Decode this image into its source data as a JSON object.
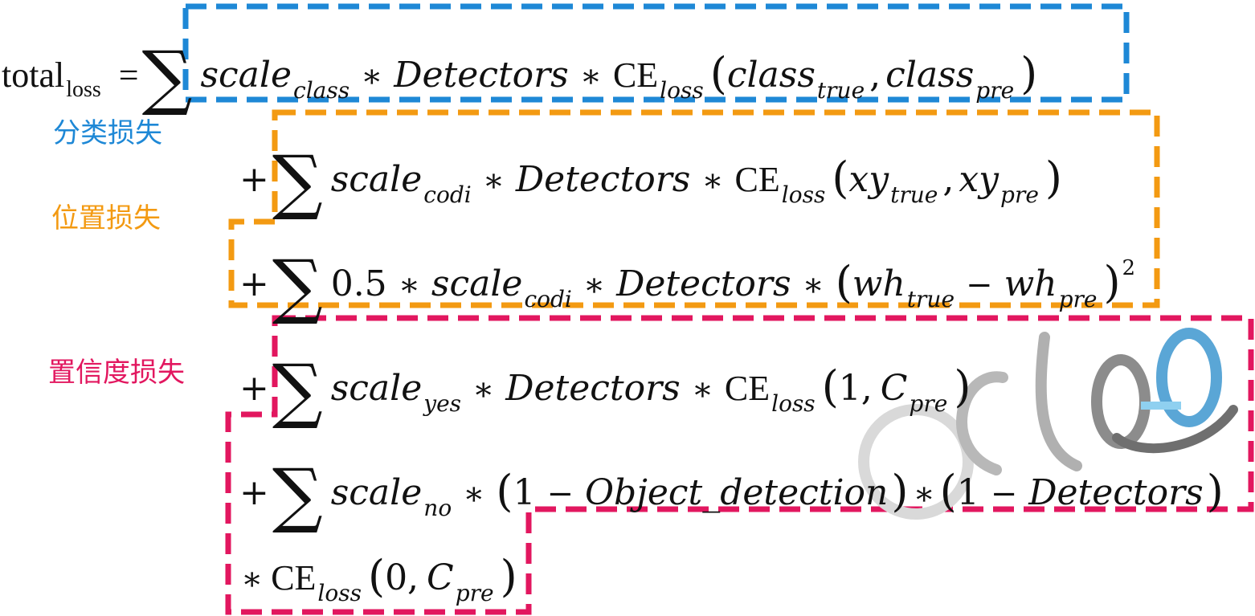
{
  "colors": {
    "class": "#1e88d6",
    "position": "#f39a12",
    "confidence": "#e2175f",
    "text": "#111111"
  },
  "labels": {
    "class_loss": "分类损失",
    "position_loss": "位置损失",
    "confidence_loss": "置信度损失"
  },
  "equation": {
    "lhs": {
      "total": "total",
      "loss_sub": "loss",
      "eq": "="
    },
    "term1": {
      "scale": "scale",
      "scale_sub": "class",
      "mul": "∗",
      "detectors": "Detectors",
      "mul2": "∗",
      "ce": "CE",
      "ce_sub": "loss",
      "arg1": "class",
      "arg1_sub": "true",
      "comma": ",",
      "arg2": "class",
      "arg2_sub": "pre"
    },
    "term2": {
      "plus": "+",
      "scale": "scale",
      "scale_sub": "codi",
      "mul": "∗",
      "detectors": "Detectors",
      "mul2": "∗",
      "ce": "CE",
      "ce_sub": "loss",
      "arg1": "xy",
      "arg1_sub": "true",
      "comma": ",",
      "arg2": "xy",
      "arg2_sub": "pre"
    },
    "term3": {
      "plus": "+",
      "coef": "0.5",
      "mul0": "∗",
      "scale": "scale",
      "scale_sub": "codi",
      "mul": "∗",
      "detectors": "Detectors",
      "mul2": "∗",
      "arg1": "wh",
      "arg1_sub": "true",
      "minus": "−",
      "arg2": "wh",
      "arg2_sub": "pre",
      "exp": "2"
    },
    "term4": {
      "plus": "+",
      "scale": "scale",
      "scale_sub": "yes",
      "mul": "∗",
      "detectors": "Detectors",
      "mul2": "∗",
      "ce": "CE",
      "ce_sub": "loss",
      "arg1": "1,",
      "arg2": "C",
      "arg2_sub": "pre"
    },
    "term5": {
      "plus": "+",
      "scale": "scale",
      "scale_sub": "no",
      "mul": "∗",
      "one1": "1",
      "minus1": "−",
      "obj": "Object_detection",
      "mul2": "∗",
      "one2": "1",
      "minus2": "−",
      "detectors": "Detectors"
    },
    "term6": {
      "mul": "∗",
      "ce": "CE",
      "ce_sub": "loss",
      "arg1": "0,",
      "arg2": "C",
      "arg2_sub": "pre"
    }
  },
  "sigma": "∑",
  "paren_open": "(",
  "paren_close": ")",
  "watermark": "cloo"
}
